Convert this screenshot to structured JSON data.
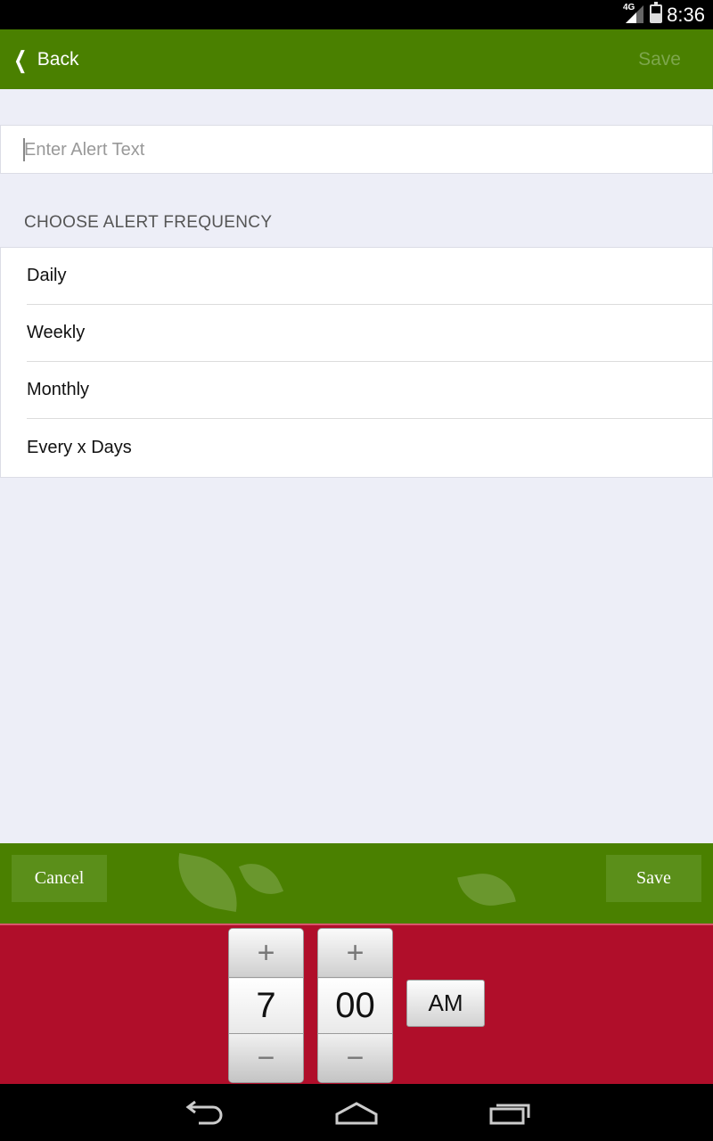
{
  "status_bar": {
    "time": "8:36",
    "network": "4G",
    "icons": [
      "signal-icon",
      "battery-icon"
    ]
  },
  "header": {
    "back_label": "Back",
    "back_icon": "chevron-left-icon",
    "save_label": "Save",
    "background_color": "#4a8000",
    "save_disabled_color": "#7da64c"
  },
  "alert_input": {
    "value": "",
    "placeholder": "Enter Alert Text"
  },
  "frequency": {
    "section_title": "CHOOSE ALERT FREQUENCY",
    "options": [
      {
        "label": "Daily"
      },
      {
        "label": "Weekly"
      },
      {
        "label": "Monthly"
      },
      {
        "label": "Every x Days"
      }
    ]
  },
  "action_bar": {
    "cancel_label": "Cancel",
    "save_label": "Save",
    "background_color": "#4a8000"
  },
  "time_picker": {
    "hour": "7",
    "minute": "00",
    "period": "AM",
    "increment_symbol": "+",
    "decrement_symbol": "−",
    "background_color": "#b00e2a"
  },
  "nav_bar": {
    "icons": [
      "back-nav-icon",
      "home-nav-icon",
      "recent-apps-icon"
    ]
  }
}
